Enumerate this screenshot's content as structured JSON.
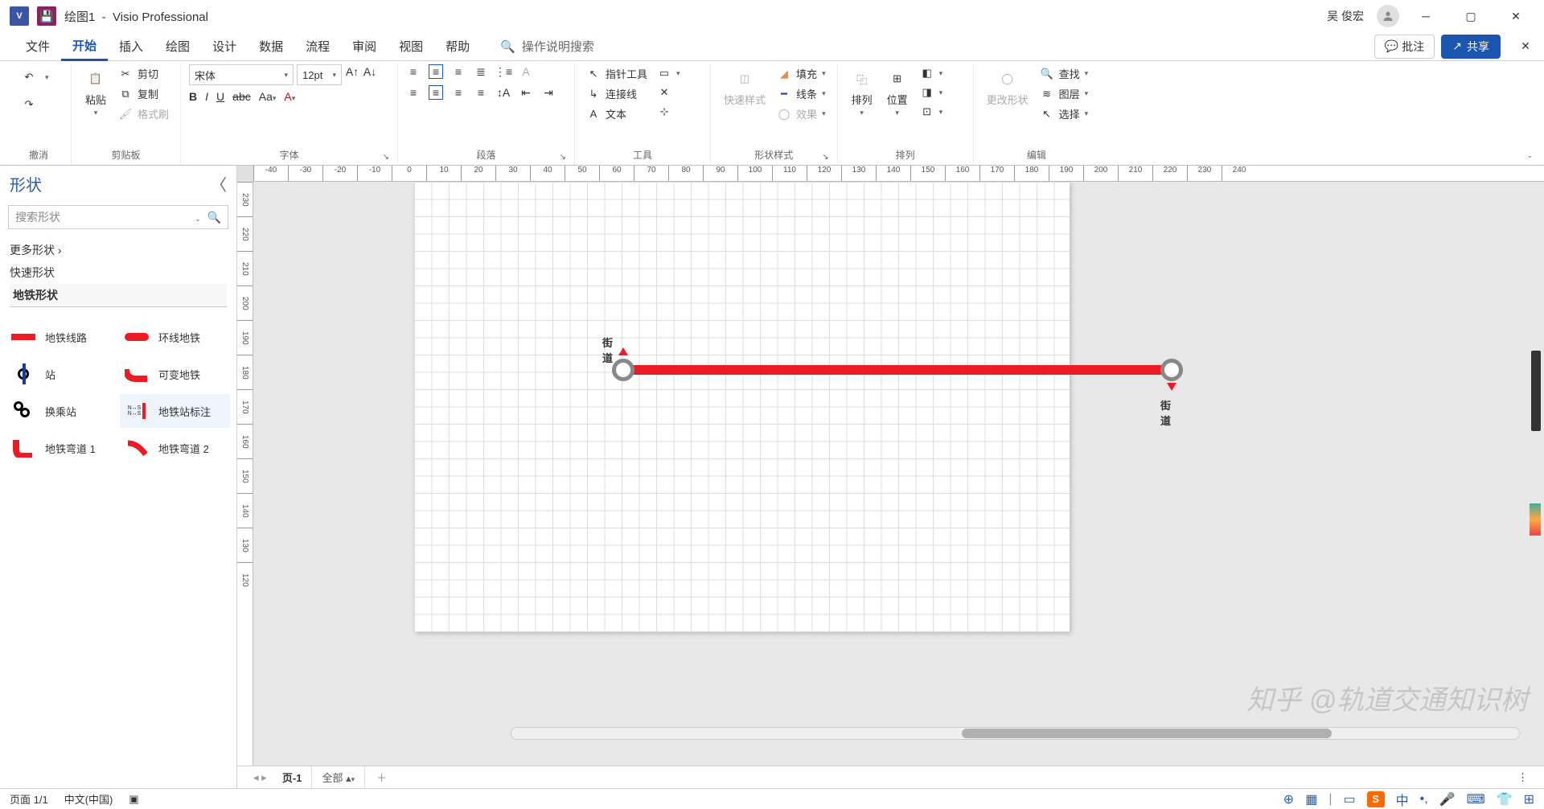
{
  "titlebar": {
    "doc": "绘图1",
    "app": "Visio Professional",
    "user": "吴 俊宏"
  },
  "tabs": {
    "file": "文件",
    "home": "开始",
    "insert": "插入",
    "draw": "绘图",
    "design": "设计",
    "data": "数据",
    "process": "流程",
    "review": "审阅",
    "view": "视图",
    "help": "帮助",
    "search_placeholder": "操作说明搜索",
    "comments": "批注",
    "share": "共享"
  },
  "ribbon": {
    "undo_group": "撤消",
    "clipboard": {
      "paste": "粘贴",
      "cut": "剪切",
      "copy": "复制",
      "format_painter": "格式刷",
      "label": "剪贴板"
    },
    "font": {
      "name": "宋体",
      "size": "12pt",
      "label": "字体"
    },
    "paragraph": {
      "label": "段落"
    },
    "tools": {
      "pointer": "指针工具",
      "connector": "连接线",
      "text": "文本",
      "label": "工具"
    },
    "styles": {
      "quick": "快速样式",
      "fill": "填充",
      "line": "线条",
      "effects": "效果",
      "label": "形状样式"
    },
    "arrange": {
      "arrange": "排列",
      "position": "位置",
      "label": "排列"
    },
    "edit": {
      "change_shape": "更改形状",
      "find": "查找",
      "layers": "图层",
      "select": "选择",
      "label": "编辑"
    }
  },
  "shapes": {
    "title": "形状",
    "search_placeholder": "搜索形状",
    "more": "更多形状",
    "quick": "快速形状",
    "metro": "地铁形状",
    "items": {
      "metro_line": "地铁线路",
      "ring_metro": "环线地铁",
      "station": "站",
      "var_metro": "可变地铁",
      "transfer": "换乘站",
      "station_label": "地铁站标注",
      "curve1": "地铁弯道 1",
      "curve2": "地铁弯道 2"
    }
  },
  "canvas": {
    "label_street_1": "街道",
    "label_street_2": "街道",
    "watermark": "知乎 @轨道交通知识树",
    "hruler": [
      "-40",
      "-30",
      "-20",
      "-10",
      "0",
      "10",
      "20",
      "30",
      "40",
      "50",
      "60",
      "70",
      "80",
      "90",
      "100",
      "110",
      "120",
      "130",
      "140",
      "150",
      "160",
      "170",
      "180",
      "190",
      "200",
      "210",
      "220",
      "230",
      "240"
    ],
    "vruler": [
      "230",
      "220",
      "210",
      "200",
      "190",
      "180",
      "170",
      "160",
      "150",
      "140",
      "130",
      "120"
    ]
  },
  "pagetabs": {
    "page1": "页-1",
    "all": "全部"
  },
  "status": {
    "page": "页面 1/1",
    "lang": "中文(中国)",
    "ime": "S",
    "cn": "中"
  }
}
